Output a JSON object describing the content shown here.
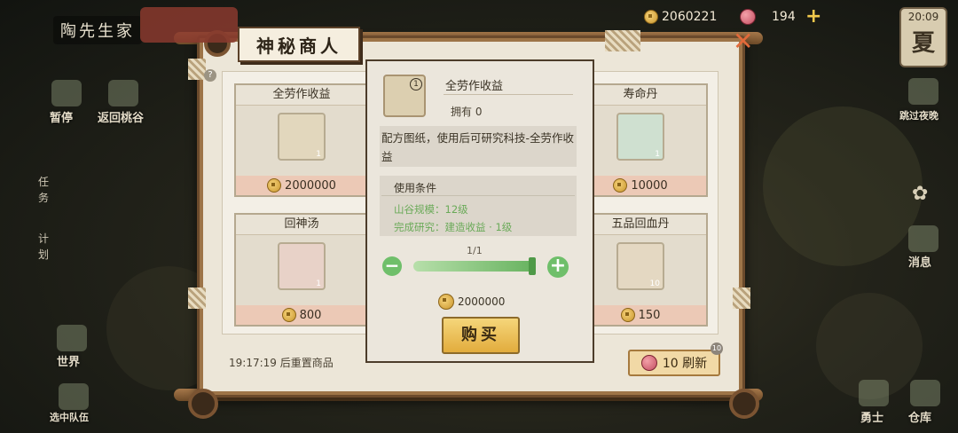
{
  "player": {
    "name": "陶先生家"
  },
  "resources": {
    "coins": "2060221",
    "peaches": "194"
  },
  "clock": {
    "time": "20:09",
    "season": "夏"
  },
  "left_menu": {
    "pause": "暂停",
    "return_valley": "返回桃谷",
    "task": [
      "任",
      "务"
    ],
    "plan": [
      "计",
      "划"
    ],
    "world": "世界",
    "team": "选中队伍"
  },
  "right_menu": {
    "skip_night": "跳过夜晚",
    "rest": "消息",
    "warrior": "勇士",
    "warehouse": "仓库"
  },
  "shop": {
    "title": "神秘商人",
    "items": [
      {
        "name": "全劳作收益",
        "count": "1",
        "price": "2000000"
      },
      {
        "name": "寿命丹",
        "count": "1",
        "price": "10000"
      },
      {
        "name": "回神汤",
        "count": "1",
        "price": "800"
      },
      {
        "name": "五品回血丹",
        "count": "10",
        "price": "150"
      }
    ],
    "reset_text": "19:17:19 后重置商品",
    "refresh_label": "10 刷新",
    "refresh_badge": "10"
  },
  "detail": {
    "name": "全劳作收益",
    "icon_badge": "1",
    "owned": "拥有 0",
    "description": "配方图纸，使用后可研究科技-全劳作收益",
    "conditions_title": "使用条件",
    "requirements": [
      "山谷规模：12级",
      "完成研究：建造收益 · 1级"
    ],
    "quantity": "1/1",
    "total_price": "2000000",
    "buy_label": "购买"
  },
  "colors": {
    "requirement": "#6aaa58",
    "slider": "#66b25e",
    "buy": "#e2ac3d"
  }
}
